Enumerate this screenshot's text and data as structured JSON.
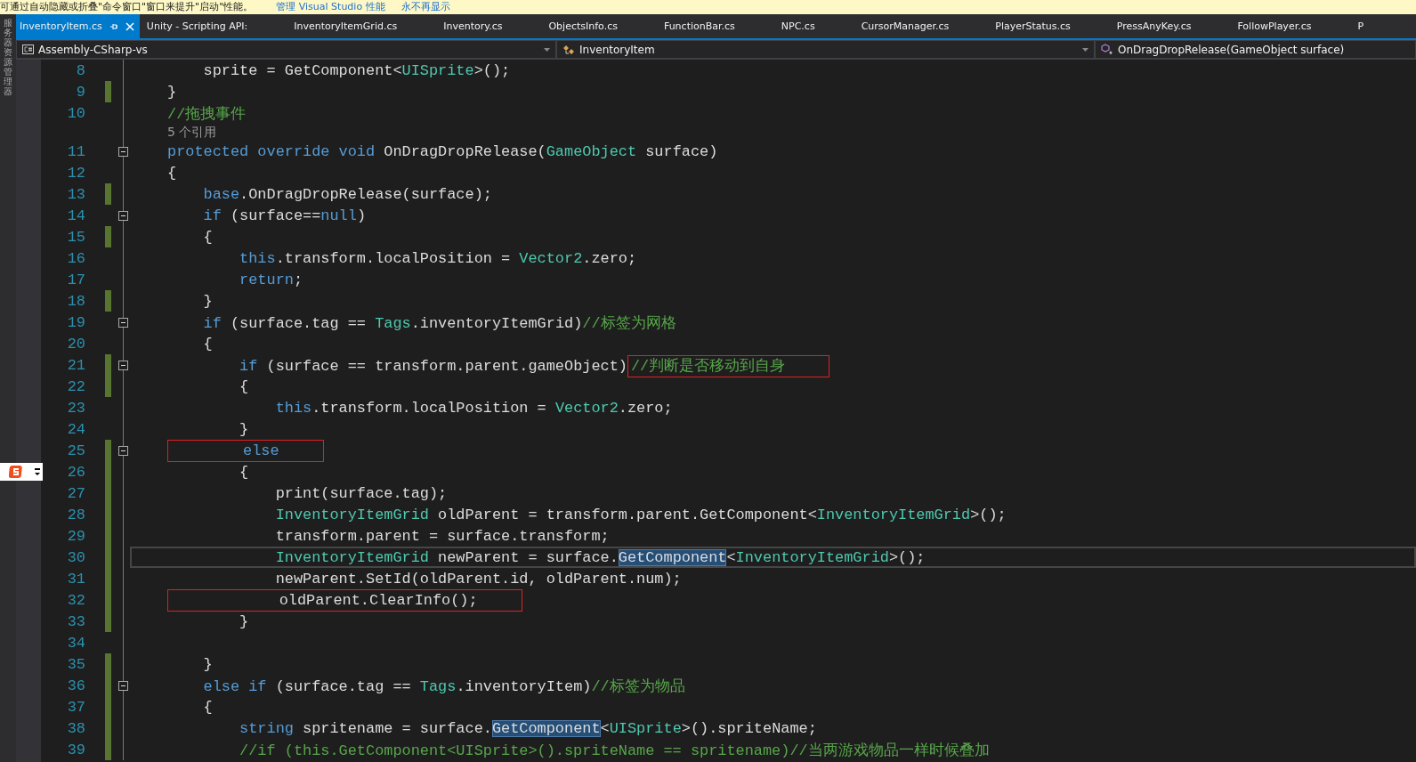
{
  "notification": {
    "message": "可通过自动隐藏或折叠\"命令窗口\"窗口来提升\"启动\"性能。",
    "links": [
      "管理 Visual Studio 性能",
      "永不再显示"
    ]
  },
  "side_panel": {
    "label": "服务器资源管理器"
  },
  "tabs": [
    {
      "label": "InventoryItem.cs",
      "selected": true
    },
    {
      "label": "Unity - Scripting API:",
      "selected": false
    },
    {
      "label": "InventoryItemGrid.cs",
      "selected": false
    },
    {
      "label": "Inventory.cs",
      "selected": false
    },
    {
      "label": "ObjectsInfo.cs",
      "selected": false
    },
    {
      "label": "FunctionBar.cs",
      "selected": false
    },
    {
      "label": "NPC.cs",
      "selected": false
    },
    {
      "label": "CursorManager.cs",
      "selected": false
    },
    {
      "label": "PlayerStatus.cs",
      "selected": false
    },
    {
      "label": "PressAnyKey.cs",
      "selected": false
    },
    {
      "label": "FollowPlayer.cs",
      "selected": false
    },
    {
      "label": "P",
      "selected": false
    }
  ],
  "nav_bar": {
    "project": "Assembly-CSharp-vs",
    "class": "InventoryItem",
    "member": "OnDragDropRelease(GameObject surface)"
  },
  "code_lines": [
    {
      "kind": "code",
      "number": "8",
      "changed": false,
      "fold": false,
      "current": false,
      "tokens": [
        {
          "text": "    sprite = GetComponent<",
          "kind": "plain"
        },
        {
          "text": "UISprite",
          "kind": "type"
        },
        {
          "text": ">();",
          "kind": "plain"
        }
      ]
    },
    {
      "kind": "code",
      "number": "9",
      "changed": true,
      "fold": false,
      "current": false,
      "tokens": [
        {
          "text": "}",
          "kind": "plain"
        }
      ]
    },
    {
      "kind": "code",
      "number": "10",
      "changed": false,
      "fold": false,
      "current": false,
      "tokens": [
        {
          "text": "//拖拽事件",
          "kind": "comment"
        }
      ]
    },
    {
      "kind": "lens",
      "text": "5 个引用"
    },
    {
      "kind": "code",
      "number": "11",
      "changed": false,
      "fold": true,
      "current": false,
      "tokens": [
        {
          "text": "protected override void ",
          "kind": "keyword"
        },
        {
          "text": "OnDragDropRelease(",
          "kind": "plain"
        },
        {
          "text": "GameObject",
          "kind": "type"
        },
        {
          "text": " surface)",
          "kind": "plain"
        }
      ]
    },
    {
      "kind": "code",
      "number": "12",
      "changed": false,
      "fold": false,
      "current": false,
      "tokens": [
        {
          "text": "{",
          "kind": "plain"
        }
      ]
    },
    {
      "kind": "code",
      "number": "13",
      "changed": true,
      "fold": false,
      "current": false,
      "tokens": [
        {
          "text": "    base",
          "kind": "keyword"
        },
        {
          "text": ".OnDragDropRelease(surface);",
          "kind": "plain"
        }
      ]
    },
    {
      "kind": "code",
      "number": "14",
      "changed": false,
      "fold": true,
      "current": false,
      "tokens": [
        {
          "text": "    if",
          "kind": "keyword"
        },
        {
          "text": " (surface==",
          "kind": "plain"
        },
        {
          "text": "null",
          "kind": "keyword"
        },
        {
          "text": ")",
          "kind": "plain"
        }
      ]
    },
    {
      "kind": "code",
      "number": "15",
      "changed": true,
      "fold": false,
      "current": false,
      "tokens": [
        {
          "text": "    {",
          "kind": "plain"
        }
      ]
    },
    {
      "kind": "code",
      "number": "16",
      "changed": false,
      "fold": false,
      "current": false,
      "tokens": [
        {
          "text": "        this",
          "kind": "keyword"
        },
        {
          "text": ".transform.localPosition = ",
          "kind": "plain"
        },
        {
          "text": "Vector2",
          "kind": "type"
        },
        {
          "text": ".zero;",
          "kind": "plain"
        }
      ]
    },
    {
      "kind": "code",
      "number": "17",
      "changed": false,
      "fold": false,
      "current": false,
      "tokens": [
        {
          "text": "        return",
          "kind": "keyword"
        },
        {
          "text": ";",
          "kind": "plain"
        }
      ]
    },
    {
      "kind": "code",
      "number": "18",
      "changed": true,
      "fold": false,
      "current": false,
      "tokens": [
        {
          "text": "    }",
          "kind": "plain"
        }
      ]
    },
    {
      "kind": "code",
      "number": "19",
      "changed": false,
      "fold": true,
      "current": false,
      "tokens": [
        {
          "text": "    if",
          "kind": "keyword"
        },
        {
          "text": " (surface.tag == ",
          "kind": "plain"
        },
        {
          "text": "Tags",
          "kind": "type"
        },
        {
          "text": ".inventoryItemGrid)",
          "kind": "plain"
        },
        {
          "text": "//标签为网格",
          "kind": "comment"
        }
      ]
    },
    {
      "kind": "code",
      "number": "20",
      "changed": false,
      "fold": false,
      "current": false,
      "tokens": [
        {
          "text": "    {",
          "kind": "plain"
        }
      ]
    },
    {
      "kind": "code",
      "number": "21",
      "changed": true,
      "fold": true,
      "current": false,
      "tokens": [
        {
          "text": "        if",
          "kind": "keyword"
        },
        {
          "text": " (surface == transform.parent.gameObject)",
          "kind": "plain"
        },
        {
          "text": "//判断是否移动到自身",
          "kind": "comment",
          "boxed": true
        }
      ]
    },
    {
      "kind": "code",
      "number": "22",
      "changed": true,
      "fold": false,
      "current": false,
      "tokens": [
        {
          "text": "        {",
          "kind": "plain"
        }
      ]
    },
    {
      "kind": "code",
      "number": "23",
      "changed": false,
      "fold": false,
      "current": false,
      "tokens": [
        {
          "text": "            this",
          "kind": "keyword"
        },
        {
          "text": ".transform.localPosition = ",
          "kind": "plain"
        },
        {
          "text": "Vector2",
          "kind": "type"
        },
        {
          "text": ".zero;",
          "kind": "plain"
        }
      ]
    },
    {
      "kind": "code",
      "number": "24",
      "changed": false,
      "fold": false,
      "current": false,
      "tokens": [
        {
          "text": "        }",
          "kind": "plain"
        }
      ]
    },
    {
      "kind": "code",
      "number": "25",
      "changed": true,
      "fold": true,
      "current": false,
      "tokens": [
        {
          "text": "        else",
          "kind": "keyword",
          "boxed": true
        }
      ]
    },
    {
      "kind": "code",
      "number": "26",
      "changed": true,
      "fold": false,
      "current": false,
      "tokens": [
        {
          "text": "        {",
          "kind": "plain"
        }
      ]
    },
    {
      "kind": "code",
      "number": "27",
      "changed": true,
      "fold": false,
      "current": false,
      "tokens": [
        {
          "text": "            print(surface.tag);",
          "kind": "plain"
        }
      ]
    },
    {
      "kind": "code",
      "number": "28",
      "changed": true,
      "fold": false,
      "current": false,
      "tokens": [
        {
          "text": "            InventoryItemGrid",
          "kind": "type"
        },
        {
          "text": " oldParent = transform.parent.GetComponent<",
          "kind": "plain"
        },
        {
          "text": "InventoryItemGrid",
          "kind": "type"
        },
        {
          "text": ">();",
          "kind": "plain"
        }
      ]
    },
    {
      "kind": "code",
      "number": "29",
      "changed": true,
      "fold": false,
      "current": false,
      "tokens": [
        {
          "text": "            transform.parent = surface.transform;",
          "kind": "plain"
        }
      ]
    },
    {
      "kind": "code",
      "number": "30",
      "changed": true,
      "fold": false,
      "current": true,
      "tokens": [
        {
          "text": "            InventoryItemGrid",
          "kind": "type"
        },
        {
          "text": " newParent = surface.",
          "kind": "plain"
        },
        {
          "text": "GetComponent",
          "kind": "plain",
          "highlighted": true
        },
        {
          "text": "<",
          "kind": "plain"
        },
        {
          "text": "InventoryItemGrid",
          "kind": "type"
        },
        {
          "text": ">();",
          "kind": "plain"
        }
      ]
    },
    {
      "kind": "code",
      "number": "31",
      "changed": true,
      "fold": false,
      "current": false,
      "tokens": [
        {
          "text": "            newParent.SetId(oldParent.id, oldParent.num);",
          "kind": "plain"
        }
      ]
    },
    {
      "kind": "code",
      "number": "32",
      "changed": true,
      "fold": false,
      "current": false,
      "tokens": [
        {
          "text": "            oldParent.ClearInfo();",
          "kind": "plain",
          "boxed": true
        }
      ]
    },
    {
      "kind": "code",
      "number": "33",
      "changed": true,
      "fold": false,
      "current": false,
      "tokens": [
        {
          "text": "        }",
          "kind": "plain"
        }
      ]
    },
    {
      "kind": "code",
      "number": "34",
      "changed": false,
      "fold": false
    },
    {
      "kind": "code",
      "number": "35",
      "changed": true,
      "fold": false,
      "current": false,
      "tokens": [
        {
          "text": "    }",
          "kind": "plain"
        }
      ]
    },
    {
      "kind": "code",
      "number": "36",
      "changed": true,
      "fold": true,
      "current": false,
      "tokens": [
        {
          "text": "    else if",
          "kind": "keyword"
        },
        {
          "text": " (surface.tag == ",
          "kind": "plain"
        },
        {
          "text": "Tags",
          "kind": "type"
        },
        {
          "text": ".inventoryItem)",
          "kind": "plain"
        },
        {
          "text": "//标签为物品",
          "kind": "comment"
        }
      ]
    },
    {
      "kind": "code",
      "number": "37",
      "changed": true,
      "fold": false,
      "current": false,
      "tokens": [
        {
          "text": "    {",
          "kind": "plain"
        }
      ]
    },
    {
      "kind": "code",
      "number": "38",
      "changed": true,
      "fold": false,
      "current": false,
      "tokens": [
        {
          "text": "        string",
          "kind": "keyword"
        },
        {
          "text": " spritename = surface.",
          "kind": "plain"
        },
        {
          "text": "GetComponent",
          "kind": "plain",
          "highlighted": true
        },
        {
          "text": "<",
          "kind": "plain"
        },
        {
          "text": "UISprite",
          "kind": "type"
        },
        {
          "text": ">().spriteName;",
          "kind": "plain"
        }
      ]
    },
    {
      "kind": "code",
      "number": "39",
      "changed": true,
      "fold": false,
      "current": false,
      "tokens": [
        {
          "text": "        //if (this.GetComponent<UISprite>().spriteName == spritename)//当两游戏物品一样时候叠加",
          "kind": "comment"
        }
      ]
    }
  ]
}
